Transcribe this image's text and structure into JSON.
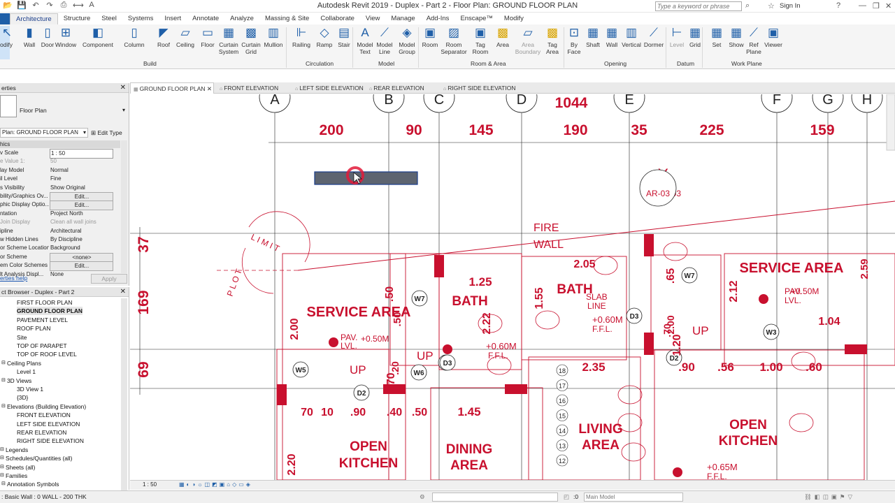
{
  "app": {
    "title": "Autodesk Revit 2019 - Duplex - Part 2 - Floor Plan: GROUND FLOOR PLAN",
    "search_placeholder": "Type a keyword or phrase",
    "sign_in": "Sign In"
  },
  "menu_tabs": [
    "Architecture",
    "Structure",
    "Steel",
    "Systems",
    "Insert",
    "Annotate",
    "Analyze",
    "Massing & Site",
    "Collaborate",
    "View",
    "Manage",
    "Add-Ins",
    "Enscape™",
    "Modify"
  ],
  "ribbon": {
    "modify": "odify",
    "build": [
      "Wall",
      "Door",
      "Window",
      "Component",
      "Column",
      "Roof",
      "Ceiling",
      "Floor",
      "Curtain System",
      "Curtain Grid",
      "Mullion"
    ],
    "circulation": [
      "Railing",
      "Ramp",
      "Stair"
    ],
    "model": [
      "Model Text",
      "Model Line",
      "Model Group"
    ],
    "room_area": [
      "Room",
      "Room Separator",
      "Tag Room",
      "Area",
      "Area Boundary",
      "Tag Area"
    ],
    "opening": [
      "By Face",
      "Shaft",
      "Wall",
      "Vertical",
      "Dormer"
    ],
    "datum": [
      "Level",
      "Grid"
    ],
    "work_plane": [
      "Set",
      "Show",
      "Ref Plane",
      "Viewer"
    ],
    "groups": [
      "Build",
      "Circulation",
      "Model",
      "Room & Area",
      "Opening",
      "Datum",
      "Work Plane"
    ]
  },
  "view_tabs": [
    "GROUND FLOOR PLAN",
    "FRONT ELEVATION",
    "LEFT SIDE ELEVATION",
    "REAR ELEVATION",
    "RIGHT SIDE ELEVATION"
  ],
  "properties": {
    "header": "erties",
    "type": "Floor Plan",
    "selector": "Plan: GROUND FLOOR PLAN",
    "edit_type": "Edit Type",
    "section": "hics",
    "rows": [
      {
        "k": "v Scale",
        "v": "1 : 50",
        "style": "box"
      },
      {
        "k": "e Value   1:",
        "v": "50",
        "style": "grey"
      },
      {
        "k": "lay Model",
        "v": "Normal",
        "style": ""
      },
      {
        "k": "il Level",
        "v": "Fine",
        "style": ""
      },
      {
        "k": "s Visibility",
        "v": "Show Original",
        "style": ""
      },
      {
        "k": "bility/Graphics Ov...",
        "v": "Edit...",
        "style": "btn"
      },
      {
        "k": "phic Display Optio...",
        "v": "Edit...",
        "style": "btn"
      },
      {
        "k": "ntation",
        "v": "Project North",
        "style": ""
      },
      {
        "k": "Join Display",
        "v": "Clean all wall joins",
        "style": "grey"
      },
      {
        "k": "ipline",
        "v": "Architectural",
        "style": ""
      },
      {
        "k": "w Hidden Lines",
        "v": "By Discipline",
        "style": ""
      },
      {
        "k": "or Scheme Location",
        "v": "Background",
        "style": ""
      },
      {
        "k": "or Scheme",
        "v": "<none>",
        "style": "btn"
      },
      {
        "k": "em Color Schemes",
        "v": "Edit...",
        "style": "btn"
      },
      {
        "k": "lt Analysis Displ...",
        "v": "None",
        "style": ""
      }
    ],
    "help": "erties help",
    "apply": "Apply"
  },
  "browser": {
    "header": "ct Browser - Duplex - Part 2",
    "items": [
      {
        "t": "FIRST FLOOR PLAN",
        "i": 24,
        "b": false
      },
      {
        "t": "GROUND FLOOR PLAN",
        "i": 24,
        "b": true
      },
      {
        "t": "PAVEMENT LEVEL",
        "i": 24,
        "b": false
      },
      {
        "t": "ROOF PLAN",
        "i": 24,
        "b": false
      },
      {
        "t": "Site",
        "i": 24,
        "b": false
      },
      {
        "t": "TOP OF PARAPET",
        "i": 24,
        "b": false
      },
      {
        "t": "TOP OF ROOF LEVEL",
        "i": 24,
        "b": false
      },
      {
        "t": "Ceiling Plans",
        "i": 10,
        "b": false
      },
      {
        "t": "Level 1",
        "i": 24,
        "b": false
      },
      {
        "t": "3D Views",
        "i": 10,
        "b": false
      },
      {
        "t": "3D View 1",
        "i": 24,
        "b": false
      },
      {
        "t": "{3D}",
        "i": 24,
        "b": false
      },
      {
        "t": "Elevations (Building Elevation)",
        "i": 10,
        "b": false
      },
      {
        "t": "FRONT ELEVATION",
        "i": 24,
        "b": false
      },
      {
        "t": "LEFT SIDE ELEVATION",
        "i": 24,
        "b": false
      },
      {
        "t": "REAR ELEVATION",
        "i": 24,
        "b": false
      },
      {
        "t": "RIGHT SIDE ELEVATION",
        "i": 24,
        "b": false
      },
      {
        "t": "Legends",
        "i": 8,
        "b": false
      },
      {
        "t": "Schedules/Quantities (all)",
        "i": 8,
        "b": false
      },
      {
        "t": "Sheets (all)",
        "i": 8,
        "b": false
      },
      {
        "t": "Families",
        "i": 8,
        "b": false
      },
      {
        "t": "Annotation Symbols",
        "i": 10,
        "b": false
      }
    ]
  },
  "drawing": {
    "grid_letters": [
      "A",
      "B",
      "C",
      "D",
      "E",
      "F",
      "G",
      "H"
    ],
    "top_dims": [
      "200",
      "90",
      "145",
      "190",
      "35",
      "225",
      "159"
    ],
    "overall_dim": "1044",
    "left_dims": [
      "37",
      "169",
      "69"
    ],
    "rooms": [
      {
        "t": "SERVICE AREA"
      },
      {
        "t": "BATH"
      },
      {
        "t": "BATH"
      },
      {
        "t": "SERVICE AREA"
      },
      {
        "t": "OPEN"
      },
      {
        "t": "KITCHEN"
      },
      {
        "t": "DINING"
      },
      {
        "t": "AREA"
      },
      {
        "t": "LIVING"
      },
      {
        "t": "AREA"
      },
      {
        "t": "OPEN"
      },
      {
        "t": "KITCHEN"
      }
    ],
    "labels": [
      "FIRE",
      "WALL",
      "SLAB",
      "LINE",
      "+0.60M",
      "F.F.L.",
      "+0.60M",
      "F.F.L.",
      "PAV.",
      "LVL.",
      "+0.50M",
      "PAV.",
      "LVL.",
      "+0.50M",
      "+0.65M",
      "F.F.L.",
      "UP",
      "UP",
      "UP",
      "L I M I T",
      "P L O T",
      "AR-03",
      "Y"
    ],
    "tags": [
      "W7",
      "W7",
      "D3",
      "D3",
      "W6",
      "D3",
      "W5",
      "D2",
      "D2",
      "W3"
    ],
    "dims": [
      "2.05",
      "1.25",
      "1.55",
      ".65",
      "2.12",
      "2.59",
      "2.22",
      "1.04",
      "2.00",
      ".50",
      ".50",
      "70",
      "10",
      ".90",
      ".40",
      ".50",
      "1.45",
      "2.35",
      ".90",
      ".56",
      "1.00",
      ".60",
      "2.20",
      "1.70",
      "1.20",
      ".20",
      "2.00",
      ".70"
    ],
    "stairs": [
      "18",
      "17",
      "16",
      "15",
      "14",
      "13",
      "12"
    ]
  },
  "bottom_strip": {
    "scale": "1 : 50"
  },
  "status": {
    "left": ": Basic Wall : 0 WALL - 200 THK",
    "coords": ":0",
    "model": "Main Model"
  }
}
